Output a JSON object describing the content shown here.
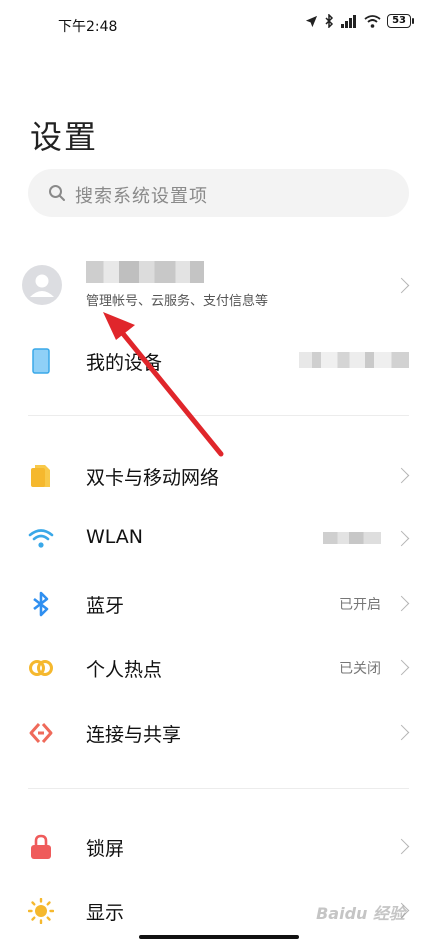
{
  "status_bar": {
    "time": "下午2:48",
    "battery": "53"
  },
  "page": {
    "title": "设置"
  },
  "search": {
    "placeholder": "搜索系统设置项"
  },
  "account": {
    "subtitle": "管理帐号、云服务、支付信息等"
  },
  "device": {
    "label": "我的设备"
  },
  "network_items": [
    {
      "label": "双卡与移动网络",
      "value": "",
      "icon": "sim-card-icon",
      "color": "#f5b82e"
    },
    {
      "label": "WLAN",
      "value": "",
      "icon": "wifi-icon",
      "color": "#3aa8e8"
    },
    {
      "label": "蓝牙",
      "value": "已开启",
      "icon": "bluetooth-icon",
      "color": "#2f8ff0"
    },
    {
      "label": "个人热点",
      "value": "已关闭",
      "icon": "hotspot-icon",
      "color": "#f5b82e"
    },
    {
      "label": "连接与共享",
      "value": "",
      "icon": "connection-share-icon",
      "color": "#ef6a5a"
    }
  ],
  "display_items": [
    {
      "label": "锁屏",
      "icon": "lock-icon",
      "color": "#ef5b5b"
    },
    {
      "label": "显示",
      "icon": "sun-icon",
      "color": "#f5b82e"
    }
  ],
  "watermark": "Baidu 经验",
  "colors": {
    "arrow": "#e0262b"
  }
}
